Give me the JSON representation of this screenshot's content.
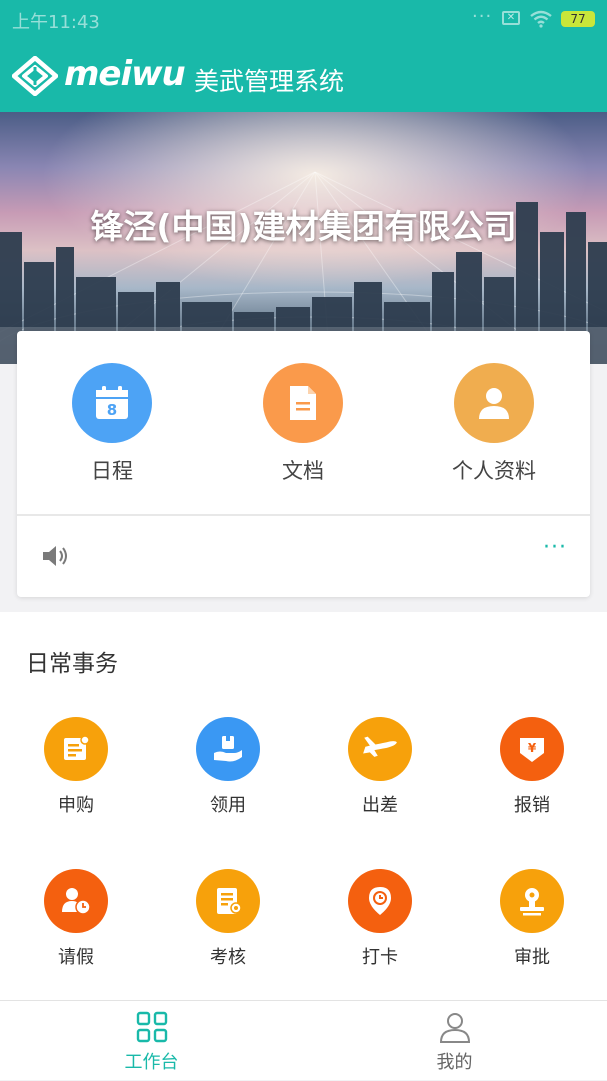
{
  "status_bar": {
    "time": "上午11:43",
    "dots": "···",
    "battery": "77"
  },
  "header": {
    "logo_text": "meiwu",
    "title": "美武管理系统",
    "accent_color": "#19b9a9"
  },
  "banner": {
    "company_name": "锋泾(中国)建材集团有限公司"
  },
  "quick_actions": [
    {
      "label": "日程",
      "icon": "calendar-icon",
      "color": "#4da3f5",
      "calendar_day": "8"
    },
    {
      "label": "文档",
      "icon": "document-icon",
      "color": "#fa9a4b"
    },
    {
      "label": "个人资料",
      "icon": "user-profile-icon",
      "color": "#f0ad4f"
    }
  ],
  "announcement": {
    "speaker_icon": "speaker-icon",
    "more": "···"
  },
  "daily": {
    "title": "日常事务",
    "items": [
      {
        "label": "申购",
        "icon": "purchase-request-icon",
        "color": "#f7a10b"
      },
      {
        "label": "领用",
        "icon": "receive-item-icon",
        "color": "#3a98f3"
      },
      {
        "label": "出差",
        "icon": "airplane-icon",
        "color": "#f7a10b"
      },
      {
        "label": "报销",
        "icon": "reimbursement-icon",
        "color": "#f4600f"
      },
      {
        "label": "请假",
        "icon": "leave-icon",
        "color": "#f4600f"
      },
      {
        "label": "考核",
        "icon": "assessment-icon",
        "color": "#f7a10b"
      },
      {
        "label": "打卡",
        "icon": "clock-in-icon",
        "color": "#f4600f"
      },
      {
        "label": "审批",
        "icon": "approval-icon",
        "color": "#f7a10b"
      }
    ]
  },
  "tabs": [
    {
      "label": "工作台",
      "active": true,
      "color": "#19b9a9"
    },
    {
      "label": "我的",
      "active": false,
      "color": "#666666"
    }
  ]
}
